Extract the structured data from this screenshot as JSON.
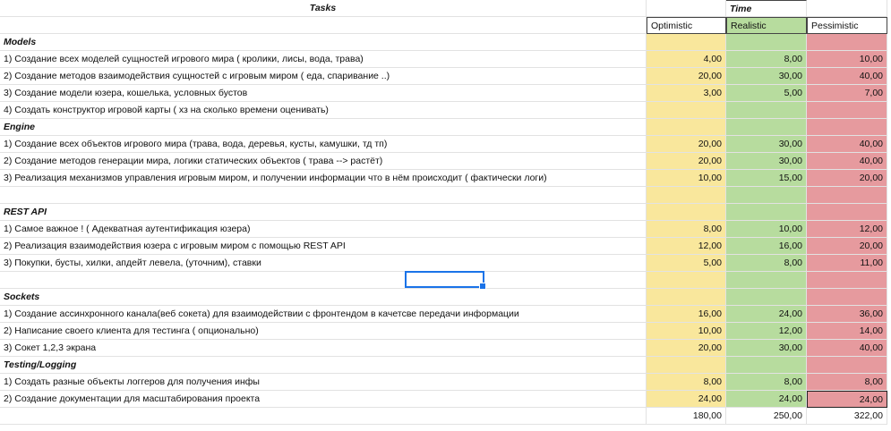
{
  "header": {
    "tasks_title": "Tasks",
    "time_title": "Time"
  },
  "columns": {
    "optimistic": "Optimistic",
    "realistic": "Realistic",
    "pessimistic": "Pessimistic"
  },
  "rows": [
    {
      "type": "section",
      "label": "Models"
    },
    {
      "type": "task",
      "label": "1) Создание всех моделей сущностей игрового мира ( кролики, лисы, вода, трава)",
      "o": "4,00",
      "r": "8,00",
      "p": "10,00"
    },
    {
      "type": "task",
      "label": "2) Создание методов взаимодействия сущностей с игровым миром ( еда, спаривание ..)",
      "o": "20,00",
      "r": "30,00",
      "p": "40,00"
    },
    {
      "type": "task",
      "label": "3) Создание модели юзера, кошелька, условных бустов",
      "o": "3,00",
      "r": "5,00",
      "p": "7,00"
    },
    {
      "type": "task",
      "label": "4) Создать конструктор игровой карты ( хз на сколько времени оценивать)",
      "o": "",
      "r": "",
      "p": ""
    },
    {
      "type": "section",
      "label": "Engine"
    },
    {
      "type": "task",
      "label": "1) Создание всех объектов игрового мира (трава, вода, деревья, кусты, камушки, тд тп)",
      "o": "20,00",
      "r": "30,00",
      "p": "40,00"
    },
    {
      "type": "task",
      "label": "2) Создание методов генерации мира, логики статических объектов ( трава --> растёт)",
      "o": "20,00",
      "r": "30,00",
      "p": "40,00"
    },
    {
      "type": "task",
      "label": "3) Реализация механизмов управления игровым миром, и получении информации что в нём происходит ( фактически логи)",
      "o": "10,00",
      "r": "15,00",
      "p": "20,00"
    },
    {
      "type": "blank"
    },
    {
      "type": "section",
      "label": "REST API"
    },
    {
      "type": "task",
      "label": "1) Самое важное ! ( Адекватная аутентификация юзера)",
      "o": "8,00",
      "r": "10,00",
      "p": "12,00"
    },
    {
      "type": "task",
      "label": "2) Реализация взаимодействия юзера с  игровым миром с помощью REST API",
      "o": "12,00",
      "r": "16,00",
      "p": "20,00"
    },
    {
      "type": "task",
      "label": "3) Покупки, бусты, хилки, апдейт левела, (уточним), ставки",
      "o": "5,00",
      "r": "8,00",
      "p": "11,00"
    },
    {
      "type": "blank"
    },
    {
      "type": "section",
      "label": "Sockets"
    },
    {
      "type": "task",
      "label": "1) Создание ассинхронного канала(веб сокета) для взаимодействии с фронтендом в качетсве передачи информации",
      "o": "16,00",
      "r": "24,00",
      "p": "36,00"
    },
    {
      "type": "task",
      "label": "2) Написание своего клиента для тестинга ( опционально)",
      "o": "10,00",
      "r": "12,00",
      "p": "14,00"
    },
    {
      "type": "task",
      "label": "3) Сокет 1,2,3 экрана",
      "o": "20,00",
      "r": "30,00",
      "p": "40,00"
    },
    {
      "type": "section",
      "label": "Testing/Logging"
    },
    {
      "type": "task",
      "label": "1) Создать разные объекты логгеров для получения инфы",
      "o": "8,00",
      "r": "8,00",
      "p": "8,00"
    },
    {
      "type": "task",
      "label": "2) Создание документации для масштабирования проекта",
      "o": "24,00",
      "r": "24,00",
      "p": "24,00"
    }
  ],
  "totals": {
    "o": "180,00",
    "r": "250,00",
    "p": "322,00"
  }
}
